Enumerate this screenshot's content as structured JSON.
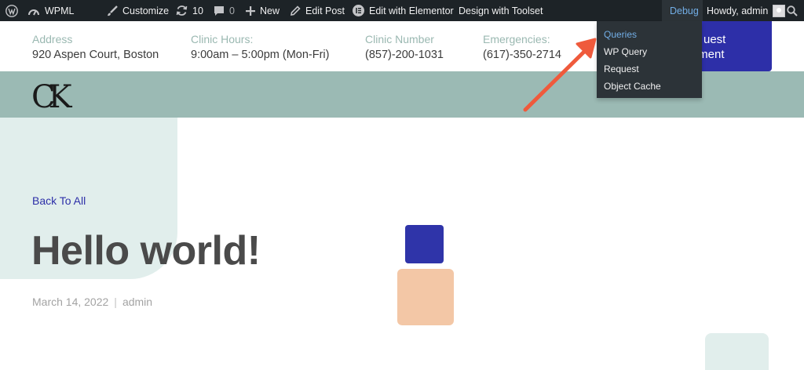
{
  "adminbar": {
    "site_name": "WPML",
    "customize": "Customize",
    "updates_count": "10",
    "comments_count": "0",
    "new": "New",
    "edit_post": "Edit Post",
    "edit_elementor": "Edit with Elementor",
    "design_toolset": "Design with Toolset",
    "debug": "Debug",
    "howdy": "Howdy, admin",
    "debug_menu": [
      "Queries",
      "WP Query",
      "Request",
      "Object Cache"
    ]
  },
  "info": {
    "address_label": "Address",
    "address_value": "920 Aspen Court, Boston",
    "hours_label": "Clinic Hours:",
    "hours_value": "9:00am – 5:00pm (Mon-Fri)",
    "number_label": "Clinic Number",
    "number_value": "(857)-200-1031",
    "emergency_label": "Emergencies:",
    "emergency_value": "(617)-350-2714",
    "cta_line1": "uest",
    "cta_line2": "tment"
  },
  "header": {
    "logo": "CK"
  },
  "post": {
    "back_link": "Back To All",
    "title": "Hello world!",
    "date": "March 14, 2022",
    "author": "admin"
  },
  "colors": {
    "adminbar_bg": "#1d2327",
    "accent_blue": "#2d2fa8",
    "band": "#9bbab4",
    "mint": "#e1eeec",
    "peach": "#f3c7a6",
    "arrow": "#ef5a3c",
    "debug_link": "#72aee6"
  }
}
